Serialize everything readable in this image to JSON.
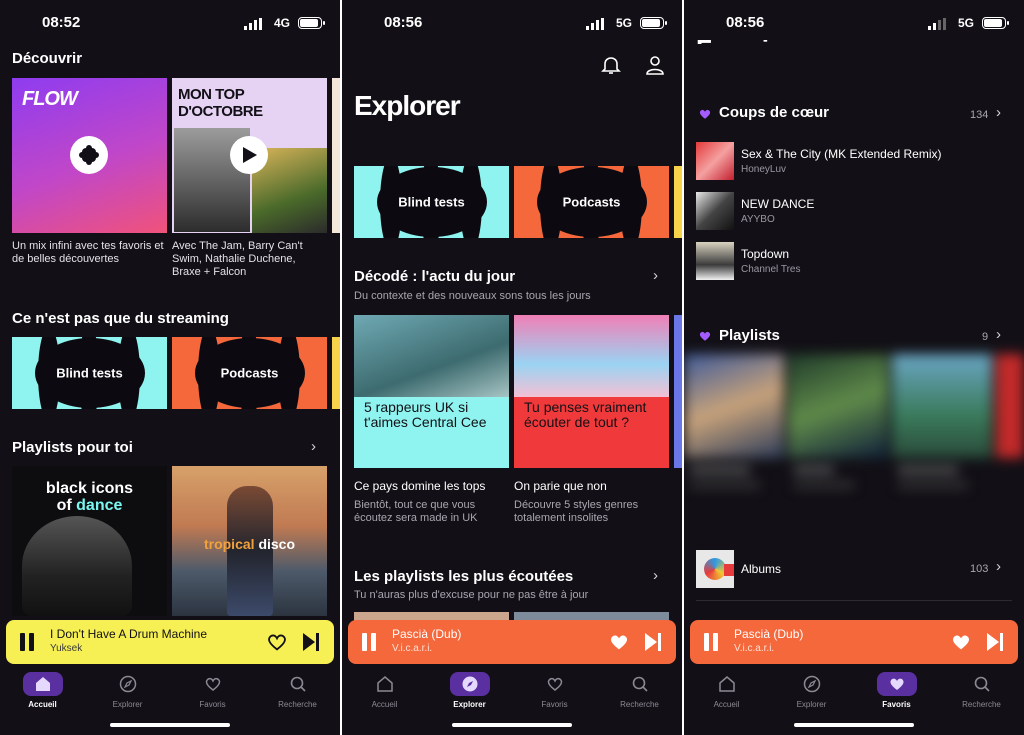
{
  "screen1": {
    "status": {
      "time": "08:52",
      "network": "4G"
    },
    "discover_title": "Découvrir",
    "cards": [
      {
        "label": "FLOW",
        "caption": "Un mix infini avec tes favoris et de belles découvertes"
      },
      {
        "label": "MON TOP D'OCTOBRE",
        "caption": "Avec The Jam, Barry Can't Swim, Nathalie Duchene, Braxe + Falcon"
      }
    ],
    "streaming_title": "Ce n'est pas que du streaming",
    "tiles": [
      "Blind tests",
      "Podcasts"
    ],
    "playlists_title": "Playlists pour toi",
    "playlists": [
      {
        "line1": "black icons",
        "line2a": "of ",
        "line2b": "dance"
      },
      {
        "line1a": "tropical ",
        "line1b": "disco"
      }
    ],
    "player": {
      "title": "I Don't Have A Drum Machine",
      "artist": "Yuksek",
      "color": "#f6f054"
    }
  },
  "screen2": {
    "status": {
      "time": "08:56",
      "network": "5G"
    },
    "title": "Explorer",
    "tiles": [
      "Blind tests",
      "Podcasts"
    ],
    "decode_title": "Décodé : l'actu du jour",
    "decode_sub": "Du contexte et des nouveaux sons tous les jours",
    "articles": [
      {
        "overlay": "5 rappeurs UK si t'aimes Central Cee",
        "title": "Ce pays domine les tops",
        "desc": "Bientôt, tout ce que vous écoutez sera made in UK"
      },
      {
        "overlay": "Tu penses vraiment écouter de tout ?",
        "title": "On parie que non",
        "desc": "Découvre 5 styles genres totalement insolites"
      }
    ],
    "top_title": "Les playlists les plus écoutées",
    "top_sub": "Tu n'auras plus d'excuse pour ne pas être à jour",
    "player": {
      "title": "Pascià (Dub)",
      "artist": "V.i.c.a.r.i.",
      "color": "#f4683c"
    }
  },
  "screen3": {
    "status": {
      "time": "08:56",
      "network": "5G"
    },
    "title": "Favoris",
    "coups_title": "Coups de cœur",
    "coups_count": "134",
    "tracks": [
      {
        "title": "Sex & The City (MK Extended Remix)",
        "artist": "HoneyLuv"
      },
      {
        "title": "NEW DANCE",
        "artist": "AYYBO"
      },
      {
        "title": "Topdown",
        "artist": "Channel Tres"
      }
    ],
    "playlists_title": "Playlists",
    "playlists_count": "9",
    "albums_title": "Albums",
    "albums_count": "103",
    "player": {
      "title": "Pascià (Dub)",
      "artist": "V.i.c.a.r.i.",
      "color": "#f4683c"
    }
  },
  "tabs": [
    "Accueil",
    "Explorer",
    "Favoris",
    "Recherche"
  ],
  "colors": {
    "background": "#121016",
    "accent": "#a35cff",
    "active_tab": "#5a2fa0"
  }
}
